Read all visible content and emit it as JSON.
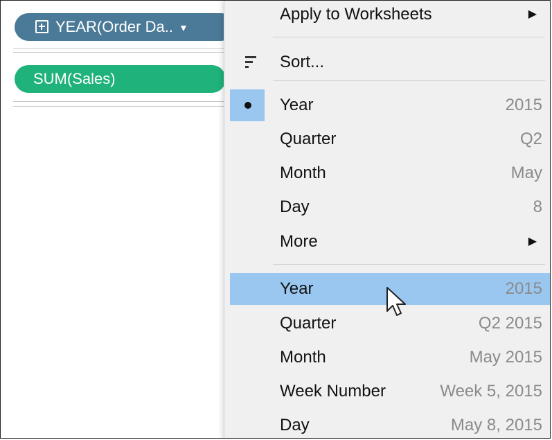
{
  "shelf": {
    "date_pill": "YEAR(Order Da..",
    "measure_pill": "SUM(Sales)"
  },
  "menu": {
    "apply_label": "Apply to Worksheets",
    "sort_label": "Sort...",
    "discrete_group": [
      {
        "label": "Year",
        "value": "2015",
        "checked": true
      },
      {
        "label": "Quarter",
        "value": "Q2"
      },
      {
        "label": "Month",
        "value": "May"
      },
      {
        "label": "Day",
        "value": "8"
      },
      {
        "label": "More",
        "value": "",
        "submenu": true
      }
    ],
    "continuous_group": [
      {
        "label": "Year",
        "value": "2015",
        "hovered": true
      },
      {
        "label": "Quarter",
        "value": "Q2 2015"
      },
      {
        "label": "Month",
        "value": "May 2015"
      },
      {
        "label": "Week Number",
        "value": "Week 5, 2015"
      },
      {
        "label": "Day",
        "value": "May 8, 2015"
      }
    ]
  },
  "colors": {
    "date_pill": "#4a7a98",
    "measure_pill": "#1fb27a",
    "highlight": "#9ac7f0",
    "menu_bg": "#f0f0f0"
  },
  "icons": {
    "date_pill": "plus-box-icon",
    "sort": "sort-icon",
    "submenu": "chevron-right-icon",
    "checked": "radio-dot-icon",
    "cursor": "mouse-pointer-icon"
  }
}
